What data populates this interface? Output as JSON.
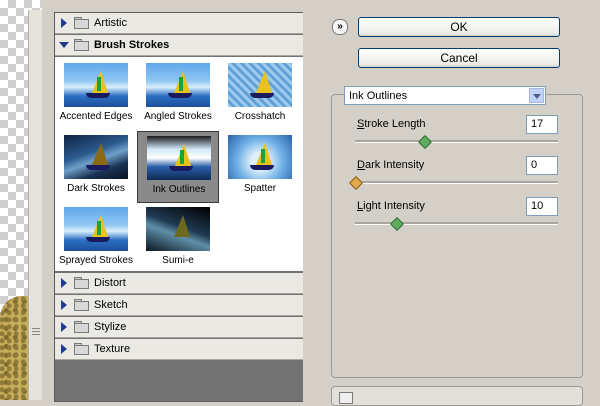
{
  "buttons": {
    "ok": "OK",
    "cancel": "Cancel",
    "collapse_glyph": "»"
  },
  "gallery": {
    "categories": [
      {
        "label": "Artistic",
        "expanded": false
      },
      {
        "label": "Brush Strokes",
        "expanded": true
      },
      {
        "label": "Distort",
        "expanded": false
      },
      {
        "label": "Sketch",
        "expanded": false
      },
      {
        "label": "Stylize",
        "expanded": false
      },
      {
        "label": "Texture",
        "expanded": false
      }
    ],
    "brush_strokes_filters": [
      {
        "label": "Accented Edges",
        "selected": false
      },
      {
        "label": "Angled Strokes",
        "selected": false
      },
      {
        "label": "Crosshatch",
        "selected": false
      },
      {
        "label": "Dark Strokes",
        "selected": false
      },
      {
        "label": "Ink Outlines",
        "selected": true
      },
      {
        "label": "Spatter",
        "selected": false
      },
      {
        "label": "Sprayed Strokes",
        "selected": false
      },
      {
        "label": "Sumi-e",
        "selected": false
      }
    ]
  },
  "settings": {
    "filter_select": "Ink Outlines",
    "params": [
      {
        "label_mnemonic": "S",
        "label_rest": "troke Length",
        "value": "17",
        "slider_fraction": 0.34
      },
      {
        "label_mnemonic": "D",
        "label_rest": "ark Intensity",
        "value": "0",
        "slider_fraction": 0.0
      },
      {
        "label_mnemonic": "L",
        "label_rest": "ight Intensity",
        "value": "10",
        "slider_fraction": 0.2
      }
    ]
  },
  "icons": {
    "collapse": "double-chevron-up-icon",
    "folder": "folder-icon",
    "expand": "disclosure-triangle-icon",
    "dropdown": "chevron-down-icon"
  },
  "colors": {
    "accent": "#003c74",
    "selected_thumb": "#8a8a8a",
    "panel": "#d4d0c8"
  }
}
